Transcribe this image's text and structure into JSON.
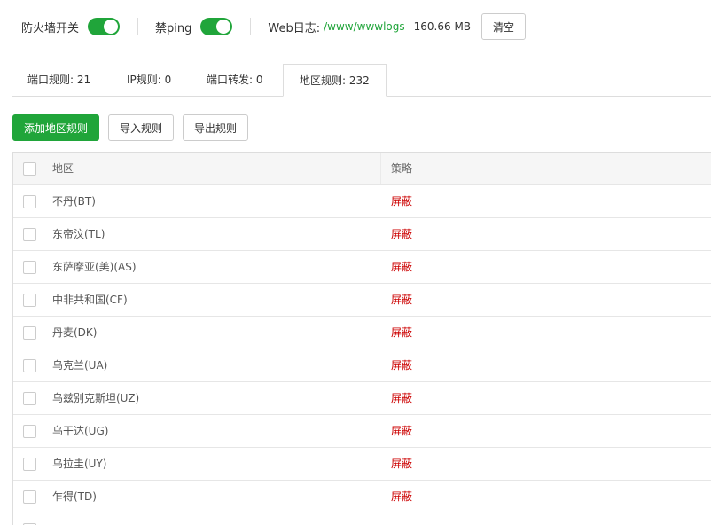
{
  "topbar": {
    "firewall_label": "防火墙开关",
    "firewall_enabled": true,
    "noping_label": "禁ping",
    "noping_enabled": true,
    "weblog_label": "Web日志:",
    "weblog_path": "/www/wwwlogs",
    "weblog_size": "160.66 MB",
    "clear_label": "清空",
    "toggle_color": "#20a53a"
  },
  "tabs": [
    {
      "label": "端口规则: 21"
    },
    {
      "label": "IP规则: 0"
    },
    {
      "label": "端口转发: 0"
    },
    {
      "label": "地区规则: 232",
      "active": true
    }
  ],
  "actions": {
    "add_label": "添加地区规则",
    "import_label": "导入规则",
    "export_label": "导出规则"
  },
  "table": {
    "headers": {
      "region": "地区",
      "policy": "策略"
    },
    "rows": [
      {
        "region": "不丹(BT)",
        "policy": "屏蔽"
      },
      {
        "region": "东帝汶(TL)",
        "policy": "屏蔽"
      },
      {
        "region": "东萨摩亚(美)(AS)",
        "policy": "屏蔽"
      },
      {
        "region": "中非共和国(CF)",
        "policy": "屏蔽"
      },
      {
        "region": "丹麦(DK)",
        "policy": "屏蔽"
      },
      {
        "region": "乌克兰(UA)",
        "policy": "屏蔽"
      },
      {
        "region": "乌兹别克斯坦(UZ)",
        "policy": "屏蔽"
      },
      {
        "region": "乌干达(UG)",
        "policy": "屏蔽"
      },
      {
        "region": "乌拉圭(UY)",
        "policy": "屏蔽"
      },
      {
        "region": "乍得(TD)",
        "policy": "屏蔽"
      }
    ],
    "policy_color": "#cc0000"
  }
}
